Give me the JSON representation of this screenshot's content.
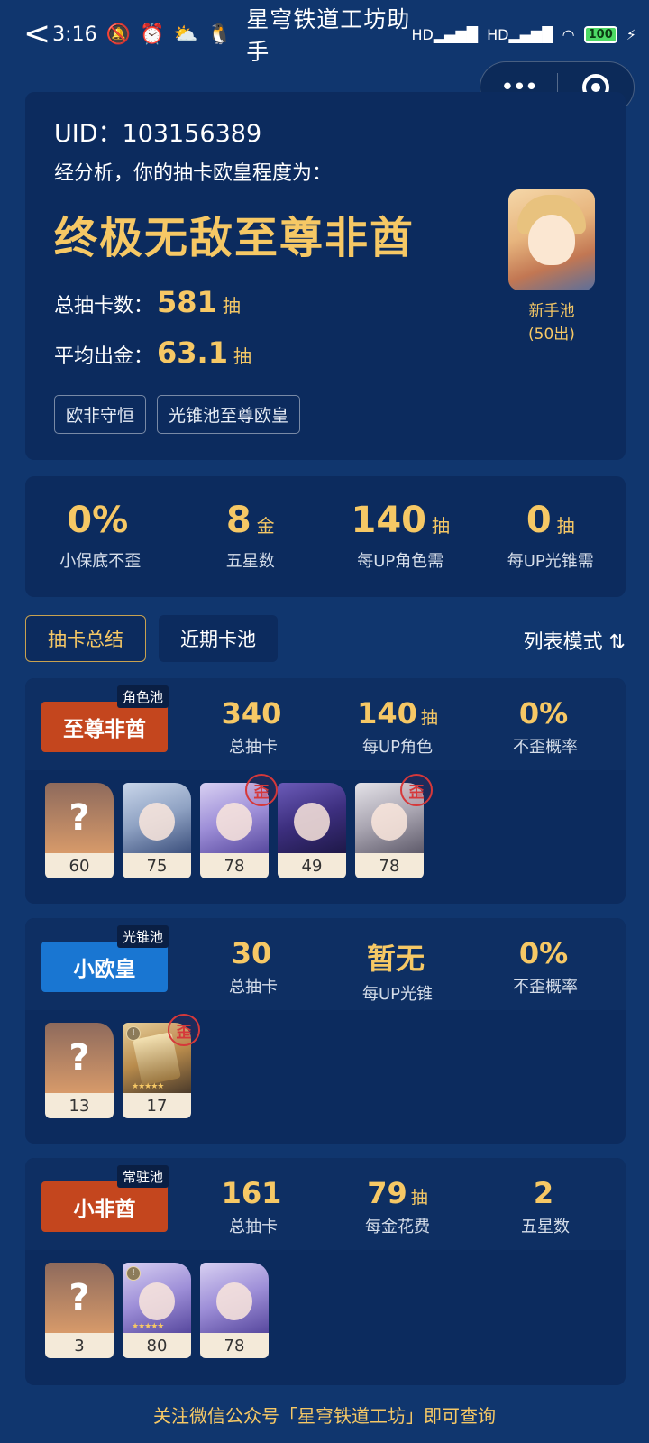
{
  "status_bar": {
    "back": "<",
    "time": "3:16",
    "app_title": "星穹铁道工坊助手",
    "signal1": "HD",
    "signal2": "HD",
    "battery": "100"
  },
  "capsule": {
    "menu_icon": "more-dots-icon",
    "close_icon": "target-icon"
  },
  "summary": {
    "uid_label": "UID：103156389",
    "intro": "经分析，你的抽卡欧皇程度为：",
    "grade": "终极无敌至尊非酋",
    "total_label": "总抽卡数：",
    "total_value": "581",
    "total_unit": "抽",
    "avg_label": "平均出金：",
    "avg_value": "63.1",
    "avg_unit": "抽",
    "tags": [
      "欧非守恒",
      "光锥池至尊欧皇"
    ],
    "featured_label": "新手池",
    "featured_sub": "(50出)"
  },
  "overview": [
    {
      "value": "0%",
      "unit": "",
      "label": "小保底不歪"
    },
    {
      "value": "8",
      "unit": "金",
      "label": "五星数"
    },
    {
      "value": "140",
      "unit": "抽",
      "label": "每UP角色需"
    },
    {
      "value": "0",
      "unit": "抽",
      "label": "每UP光锥需"
    }
  ],
  "tabs": {
    "summary": "抽卡总结",
    "recent": "近期卡池",
    "view_mode": "列表模式 ⇅"
  },
  "pools": [
    {
      "type": "角色池",
      "badge": "至尊非酋",
      "badge_color": "#c4461e",
      "m1_value": "340",
      "m1_unit": "",
      "m1_label": "总抽卡",
      "m2_value": "140",
      "m2_unit": "抽",
      "m2_label": "每UP角色",
      "m3_value": "0%",
      "m3_unit": "",
      "m3_label": "不歪概率",
      "items": [
        {
          "pic": "?",
          "count": "60"
        },
        {
          "pic": "",
          "count": "75"
        },
        {
          "pic": "",
          "count": "78",
          "wai": "歪"
        },
        {
          "pic": "",
          "count": "49"
        },
        {
          "pic": "",
          "count": "78",
          "wai": "歪"
        }
      ]
    },
    {
      "type": "光锥池",
      "badge": "小欧皇",
      "badge_color": "#1976d2",
      "m1_value": "30",
      "m1_unit": "",
      "m1_label": "总抽卡",
      "m2_value": "暂无",
      "m2_unit": "",
      "m2_label": "每UP光锥",
      "m3_value": "0%",
      "m3_unit": "",
      "m3_label": "不歪概率",
      "items": [
        {
          "pic": "?",
          "count": "13"
        },
        {
          "pic": "",
          "count": "17",
          "wai": "歪"
        }
      ]
    },
    {
      "type": "常驻池",
      "badge": "小非酋",
      "badge_color": "#c4461e",
      "m1_value": "161",
      "m1_unit": "",
      "m1_label": "总抽卡",
      "m2_value": "79",
      "m2_unit": "抽",
      "m2_label": "每金花费",
      "m3_value": "2",
      "m3_unit": "",
      "m3_label": "五星数",
      "items": [
        {
          "pic": "?",
          "count": "3"
        },
        {
          "pic": "",
          "count": "80"
        },
        {
          "pic": "",
          "count": "78"
        }
      ]
    }
  ],
  "footer": "关注微信公众号「星穹铁道工坊」即可查询"
}
